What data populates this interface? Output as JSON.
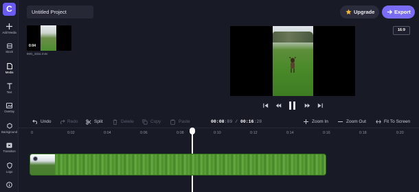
{
  "app": {
    "logo_letter": "C",
    "brand_color": "#6a5cf2",
    "accent_color": "#7a6cf5",
    "background_color": "#181a26"
  },
  "sidebar": {
    "items": [
      {
        "label": "Add Media",
        "icon": "plus-icon"
      },
      {
        "label": "Stock",
        "icon": "stock-icon"
      },
      {
        "label": "Media",
        "icon": "media-icon",
        "active": true
      },
      {
        "label": "Text",
        "icon": "text-icon"
      },
      {
        "label": "Overlay",
        "icon": "overlay-icon"
      },
      {
        "label": "Background",
        "icon": "background-icon"
      },
      {
        "label": "Transition",
        "icon": "transition-icon"
      },
      {
        "label": "Logo",
        "icon": "logo-icon"
      },
      {
        "label": "",
        "icon": "info-icon"
      }
    ]
  },
  "header": {
    "project_title": "Untitled Project",
    "upgrade_label": "Upgrade",
    "export_label": "Export"
  },
  "media": {
    "items": [
      {
        "duration": "0:04",
        "filename": "IMG_3311.m4v"
      }
    ]
  },
  "preview": {
    "aspect_ratio": "16:9"
  },
  "toolbar": {
    "undo_label": "Undo",
    "redo_label": "Redo",
    "split_label": "Split",
    "delete_label": "Delete",
    "copy_label": "Copy",
    "paste_label": "Paste",
    "zoom_in_label": "Zoom In",
    "zoom_out_label": "Zoom Out",
    "fit_label": "Fit To Screen"
  },
  "timecode": {
    "current_main": "00:08",
    "current_frames": ":89",
    "total_main": "00:16",
    "total_frames": ":28",
    "separator": "/"
  },
  "ruler": {
    "labels": [
      "0",
      "0:02",
      "0:04",
      "0:06",
      "0:08",
      "0:10",
      "0:12",
      "0:14",
      "0:16",
      "0:18",
      "0:20"
    ]
  },
  "timeline": {
    "clip_name": "IMG_3311.m4v",
    "playhead_fraction": 0.5
  }
}
